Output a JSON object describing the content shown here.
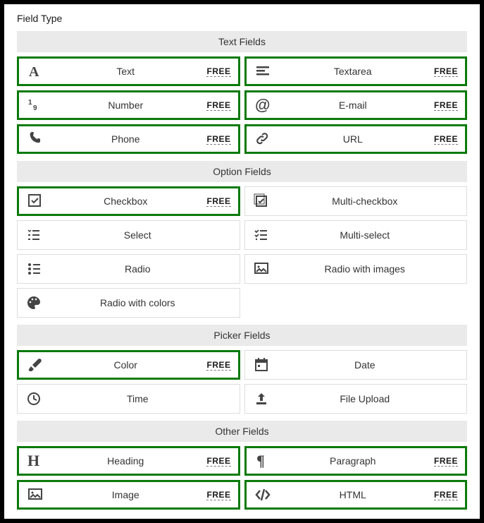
{
  "title": "Field Type",
  "badge_free": "FREE",
  "sections": [
    {
      "header": "Text Fields",
      "items": [
        {
          "id": "text",
          "label": "Text",
          "icon": "font-icon",
          "selected": true,
          "free": true
        },
        {
          "id": "textarea",
          "label": "Textarea",
          "icon": "align-left-icon",
          "selected": true,
          "free": true
        },
        {
          "id": "number",
          "label": "Number",
          "icon": "number-icon",
          "selected": true,
          "free": true
        },
        {
          "id": "email",
          "label": "E-mail",
          "icon": "at-icon",
          "selected": true,
          "free": true
        },
        {
          "id": "phone",
          "label": "Phone",
          "icon": "phone-icon",
          "selected": true,
          "free": true
        },
        {
          "id": "url",
          "label": "URL",
          "icon": "link-icon",
          "selected": true,
          "free": true
        }
      ]
    },
    {
      "header": "Option Fields",
      "items": [
        {
          "id": "checkbox",
          "label": "Checkbox",
          "icon": "checkbox-icon",
          "selected": true,
          "free": true
        },
        {
          "id": "multi-checkbox",
          "label": "Multi-checkbox",
          "icon": "multicheck-icon",
          "selected": false,
          "free": false
        },
        {
          "id": "select",
          "label": "Select",
          "icon": "select-icon",
          "selected": false,
          "free": false
        },
        {
          "id": "multi-select",
          "label": "Multi-select",
          "icon": "multiselect-icon",
          "selected": false,
          "free": false
        },
        {
          "id": "radio",
          "label": "Radio",
          "icon": "radio-icon",
          "selected": false,
          "free": false
        },
        {
          "id": "radio-images",
          "label": "Radio with images",
          "icon": "image-icon",
          "selected": false,
          "free": false
        },
        {
          "id": "radio-colors",
          "label": "Radio with colors",
          "icon": "palette-icon",
          "selected": false,
          "free": false
        }
      ]
    },
    {
      "header": "Picker Fields",
      "items": [
        {
          "id": "color",
          "label": "Color",
          "icon": "brush-icon",
          "selected": true,
          "free": true
        },
        {
          "id": "date",
          "label": "Date",
          "icon": "calendar-icon",
          "selected": false,
          "free": false
        },
        {
          "id": "time",
          "label": "Time",
          "icon": "clock-icon",
          "selected": false,
          "free": false
        },
        {
          "id": "file",
          "label": "File Upload",
          "icon": "upload-icon",
          "selected": false,
          "free": false
        }
      ]
    },
    {
      "header": "Other Fields",
      "items": [
        {
          "id": "heading",
          "label": "Heading",
          "icon": "heading-icon",
          "selected": true,
          "free": true
        },
        {
          "id": "paragraph",
          "label": "Paragraph",
          "icon": "paragraph-icon",
          "selected": true,
          "free": true
        },
        {
          "id": "image",
          "label": "Image",
          "icon": "image-icon",
          "selected": true,
          "free": true
        },
        {
          "id": "html",
          "label": "HTML",
          "icon": "code-icon",
          "selected": true,
          "free": true
        }
      ]
    }
  ]
}
